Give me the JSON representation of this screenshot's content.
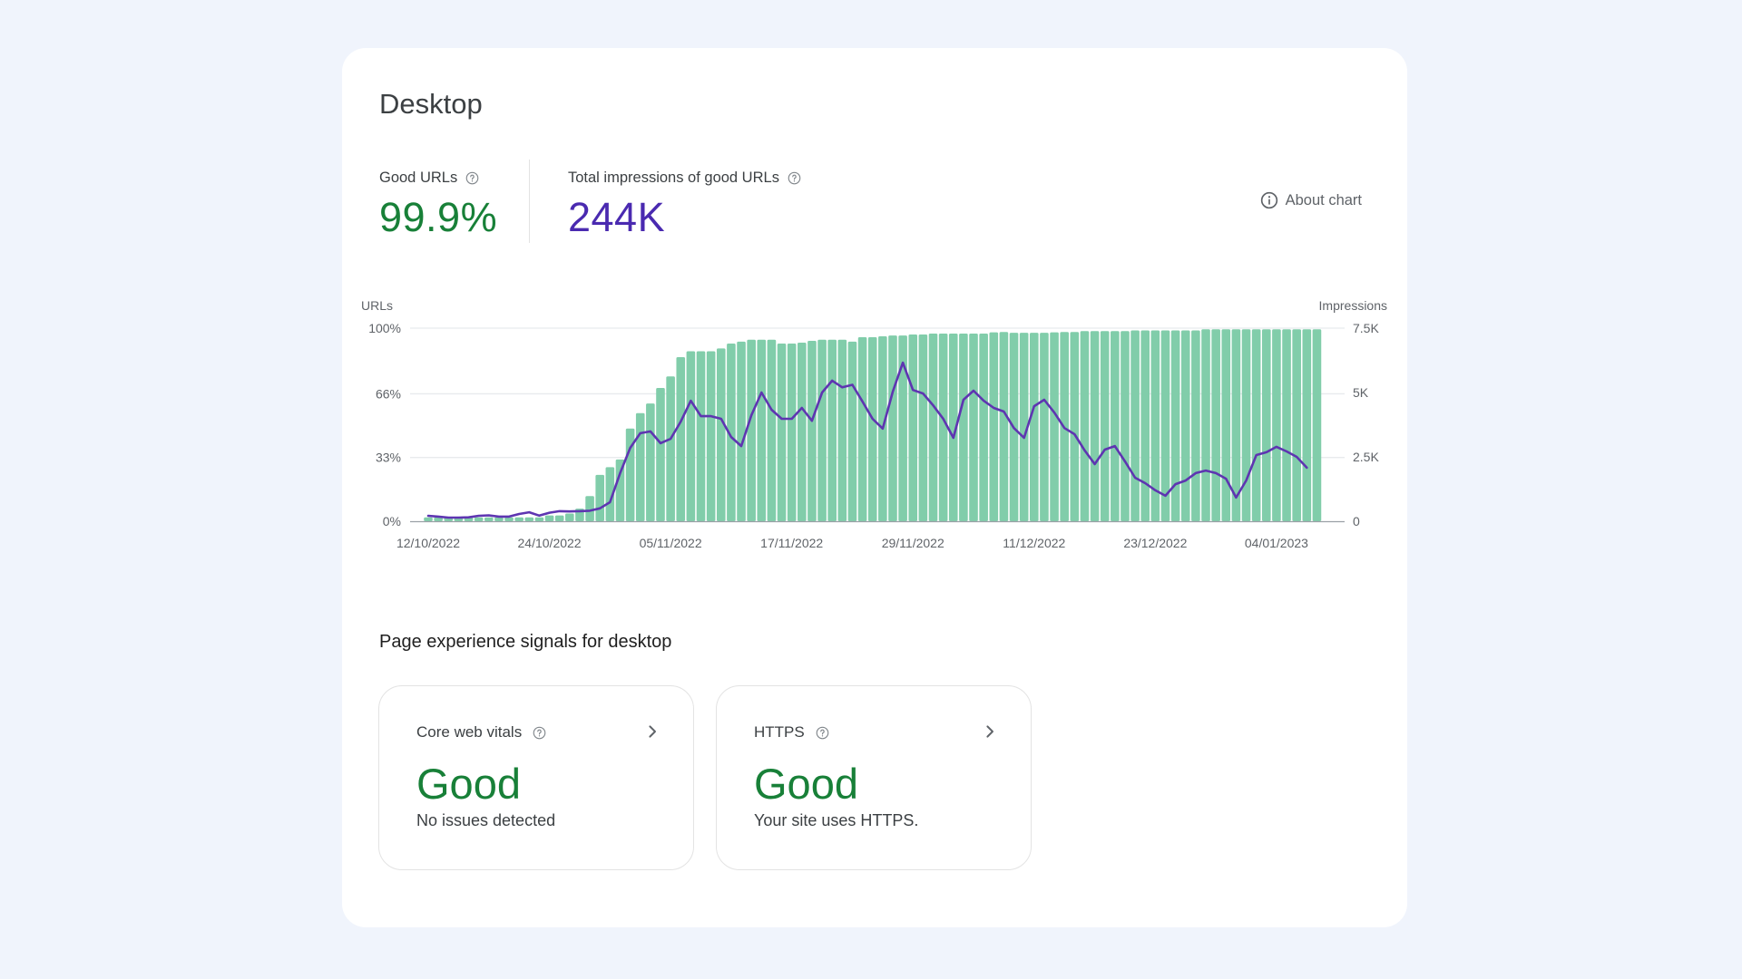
{
  "card": {
    "title": "Desktop",
    "about_label": "About chart",
    "metrics": [
      {
        "label": "Good URLs",
        "value": "99.9%",
        "color": "#188038"
      },
      {
        "label": "Total impressions of good URLs",
        "value": "244K",
        "color": "#4a2ab0"
      }
    ]
  },
  "signals": {
    "title": "Page experience signals for desktop",
    "items": [
      {
        "label": "Core web vitals",
        "status": "Good",
        "description": "No issues detected"
      },
      {
        "label": "HTTPS",
        "status": "Good",
        "description": "Your site uses HTTPS."
      }
    ]
  },
  "chart_data": {
    "type": "bar+line",
    "title": "",
    "start_date": "12/10/2022",
    "x_tick_labels": [
      "12/10/2022",
      "24/10/2022",
      "05/11/2022",
      "17/11/2022",
      "29/11/2022",
      "11/12/2022",
      "23/12/2022",
      "04/01/2023"
    ],
    "x_tick_step_days": 12,
    "left_axis": {
      "label": "URLs",
      "ticks": [
        "0%",
        "33%",
        "66%",
        "100%"
      ],
      "tick_values": [
        0,
        33,
        66,
        100
      ],
      "range": [
        0,
        100
      ]
    },
    "right_axis": {
      "label": "Impressions",
      "ticks": [
        "0",
        "2.5K",
        "5K",
        "7.5K"
      ],
      "tick_values": [
        0,
        2500,
        5000,
        7500
      ],
      "range": [
        0,
        7500
      ]
    },
    "grid": true,
    "series": [
      {
        "name": "Good URLs (%)",
        "type": "bar",
        "axis": "left",
        "color": "#81cdaa",
        "values": [
          2,
          2,
          2,
          2,
          2,
          2,
          2,
          2,
          2,
          2,
          2,
          2,
          3,
          3,
          4,
          6.5,
          13,
          24,
          28,
          32,
          48,
          56,
          61,
          69,
          75,
          85,
          88,
          88,
          88,
          89.5,
          92,
          93,
          94,
          94,
          94,
          92,
          92,
          92.5,
          93.4,
          94,
          94,
          94,
          93,
          95.3,
          95.3,
          95.8,
          96.2,
          96.2,
          96.7,
          96.7,
          97.2,
          97.2,
          97.2,
          97.2,
          97.2,
          97.2,
          97.8,
          98,
          97.6,
          97.6,
          97.6,
          97.6,
          97.8,
          98,
          98,
          98.5,
          98.5,
          98.5,
          98.5,
          98.5,
          98.8,
          98.8,
          98.8,
          98.8,
          98.8,
          98.8,
          98.8,
          99.4,
          99.4,
          99.4,
          99.4,
          99.4,
          99.4,
          99.4,
          99.4,
          99.4,
          99.4,
          99.4,
          99.4
        ]
      },
      {
        "name": "Impressions",
        "type": "line",
        "axis": "right",
        "color": "#5e35b1",
        "values": [
          210,
          180,
          140,
          140,
          150,
          210,
          230,
          180,
          180,
          280,
          350,
          220,
          330,
          390,
          380,
          390,
          410,
          500,
          740,
          1870,
          2850,
          3420,
          3490,
          3030,
          3200,
          3870,
          4680,
          4080,
          4080,
          3980,
          3270,
          2920,
          4120,
          5000,
          4330,
          3980,
          3980,
          4400,
          3900,
          5000,
          5460,
          5200,
          5300,
          4650,
          3980,
          3600,
          5030,
          6160,
          5100,
          4960,
          4500,
          3980,
          3240,
          4720,
          5070,
          4680,
          4400,
          4260,
          3620,
          3240,
          4470,
          4720,
          4220,
          3620,
          3380,
          2750,
          2220,
          2780,
          2920,
          2320,
          1690,
          1480,
          1200,
          990,
          1440,
          1580,
          1870,
          1970,
          1870,
          1650,
          920,
          1580,
          2570,
          2680,
          2890,
          2710,
          2500,
          2080
        ]
      }
    ]
  }
}
